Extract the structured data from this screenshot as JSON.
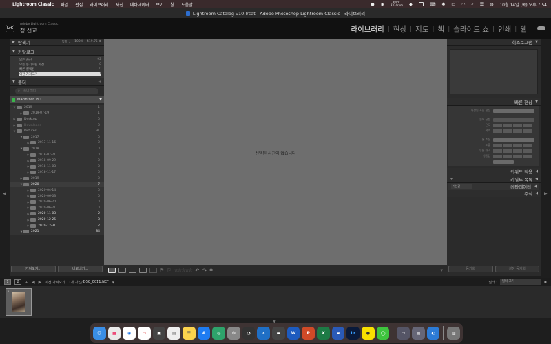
{
  "menubar": {
    "app_name": "Lightroom Classic",
    "items": [
      "파일",
      "편집",
      "라이브러리",
      "사진",
      "메타데이터",
      "보기",
      "창",
      "도움말"
    ],
    "cpu_label": "64°C",
    "cpu_rpm": "3334rpm",
    "clock": "10월 14일 (목) 오후 7:54"
  },
  "window": {
    "title": "Lightroom Catalog-v10.lrcat - Adobe Photoshop Lightroom Classic - 라이브러리"
  },
  "identity": {
    "logo": "LrC",
    "small_text": "Adobe Lightroom Classic",
    "user_name": "정 선교"
  },
  "modules": {
    "items": [
      "라이브러리",
      "현상",
      "지도",
      "책",
      "슬라이드 쇼",
      "인쇄",
      "웹"
    ],
    "active": "라이브러리"
  },
  "left_panel": {
    "navigator": {
      "label": "탐색기",
      "zoom": [
        "맞춤 ↕",
        "100%",
        "419.75 ↕"
      ]
    },
    "catalog": {
      "label": "카탈로그",
      "rows": [
        {
          "name": "모든 사진",
          "count": "92"
        },
        {
          "name": "모든 동기화된 사진",
          "count": "0"
        },
        {
          "name": "빠른 컬렉션 +",
          "count": "0"
        },
        {
          "name": "이전 가져오기",
          "count": "1"
        }
      ]
    },
    "folders": {
      "label": "폴더",
      "add": "+",
      "search_placeholder": "폴더 필터",
      "volume": "Macintosh HD",
      "tree": [
        {
          "name": "2019",
          "count": "1"
        },
        {
          "name": "2019-07-19",
          "count": "1"
        },
        {
          "name": "Desktop",
          "count": "0"
        },
        {
          "name": "Downloads",
          "count": "0"
        },
        {
          "name": "Pictures",
          "count": "91"
        },
        {
          "name": "2017",
          "count": "0"
        },
        {
          "name": "2017-11-16",
          "count": "0"
        },
        {
          "name": "2018",
          "count": "0"
        },
        {
          "name": "2018-07-21",
          "count": "0"
        },
        {
          "name": "2018-09-29",
          "count": "0"
        },
        {
          "name": "2018-11-03",
          "count": "0"
        },
        {
          "name": "2018-11-17",
          "count": "0"
        },
        {
          "name": "2019",
          "count": "0"
        },
        {
          "name": "2020",
          "count": "7"
        },
        {
          "name": "2020-04-14",
          "count": "0"
        },
        {
          "name": "2020-06-03",
          "count": "0"
        },
        {
          "name": "2020-06-20",
          "count": "0"
        },
        {
          "name": "2020-06-21",
          "count": "0"
        },
        {
          "name": "2020-11-03",
          "count": "2"
        },
        {
          "name": "2020-12-25",
          "count": "3"
        },
        {
          "name": "2020-12-31",
          "count": "2"
        },
        {
          "name": "2021",
          "count": "84"
        }
      ]
    },
    "buttons": {
      "import": "가져오기...",
      "export": "내보내기..."
    }
  },
  "center": {
    "empty_message": "선택된 사진이 없습니다"
  },
  "right_panel": {
    "histogram": "히스토그램",
    "quick_develop": {
      "label": "빠른 현상",
      "rows": [
        "저장된 사전 설정",
        "흰색 균형",
        "온도",
        "색조",
        "톤 조절",
        "노출",
        "부분 대비",
        "생동감"
      ]
    },
    "keywording": "키워드 적용",
    "keyword_list": "키워드 목록",
    "keyword_plus": "+",
    "metadata": "메타데이터",
    "metadata_preset": "기본값",
    "comments": "주석",
    "buttons": {
      "sync": "동기화",
      "sync_settings": "설정 동기화"
    }
  },
  "filmstrip": {
    "pages": [
      "1",
      "2"
    ],
    "source": "이전 가져오기",
    "info": "1개 사진/",
    "filename": "DSC_0011.NEF",
    "filter_label": "필터 :",
    "filter_value": "필터 끄기"
  }
}
